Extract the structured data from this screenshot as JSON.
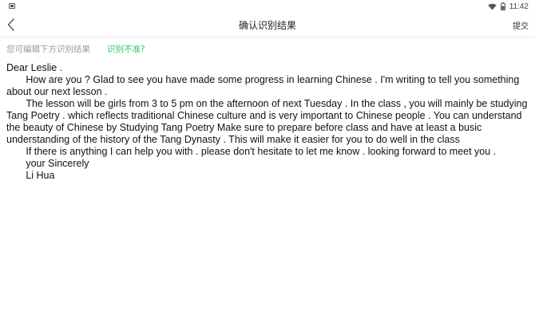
{
  "status_bar": {
    "time": "11:42",
    "icons": [
      "image-icon",
      "wifi-icon",
      "battery-icon"
    ]
  },
  "header": {
    "title": "确认识别结果",
    "submit_label": "提交",
    "back_icon": "chevron-left-icon"
  },
  "hint": {
    "text": "您可编辑下方识别结果",
    "link": "识别不准?"
  },
  "result": {
    "text": "Dear Leslie .\n       How are you ? Glad to see you have made some progress in learning Chinese . I'm writing to tell you something about our next lesson .\n       The lesson will be girls from 3 to 5 pm on the afternoon of next Tuesday . In the class , you will mainly be studying Tang Poetry . which reflects traditional Chinese culture and is very important to Chinese people . You can understand the beauty of Chinese by Studying Tang Poetry Make sure to prepare before class and have at least a busic understanding of the history of the Tang Dynasty . This will make it easier for you to do well in the class\n       If there is anything I can help you with . please don't hesitate to let me know . looking forward to meet you .\n       your Sincerely\n       Li Hua"
  },
  "colors": {
    "accent": "#2cc36b",
    "hint_text": "#9a9a9a",
    "background": "#ffffff"
  }
}
